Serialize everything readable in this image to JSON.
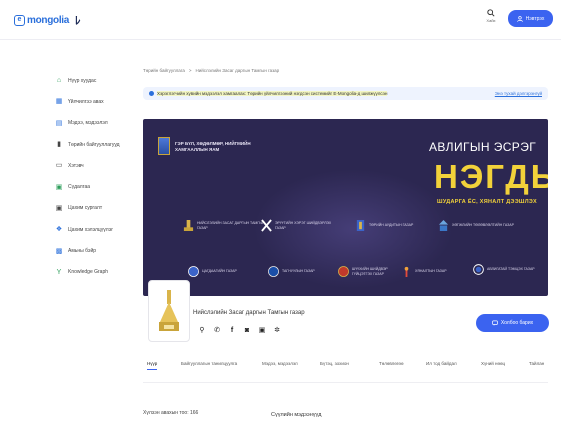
{
  "header": {
    "logo_text": "mongolia",
    "logo_letter": "e",
    "search_label": "Хайх",
    "login_label": "Нэвтрэх"
  },
  "sidebar": {
    "items": [
      {
        "label": "Нүүр хуудас",
        "icon": "home-icon"
      },
      {
        "label": "Үйлчилгээ авах",
        "icon": "services-icon"
      },
      {
        "label": "Мэдээ, мэдээлэл",
        "icon": "news-icon"
      },
      {
        "label": "Төрийн байгууллагууд",
        "icon": "organization-icon"
      },
      {
        "label": "Хэтэвч",
        "icon": "wallet-icon"
      },
      {
        "label": "Сүдалгаа",
        "icon": "survey-icon"
      },
      {
        "label": "Цахим сургалт",
        "icon": "e-learning-icon"
      },
      {
        "label": "Цахим хэлэлцүүлэг",
        "icon": "discussion-icon"
      },
      {
        "label": "Амьны бэйр",
        "icon": "life-event-icon"
      },
      {
        "label": "Knowledge Graph",
        "icon": "knowledge-graph-icon"
      }
    ]
  },
  "breadcrumb": {
    "parent": "Төрийн байгууллага",
    "separator": ">",
    "current": "Нийслэлийн Засаг даргын Тамгын газар"
  },
  "notice": {
    "text": "Хэрэглэгчийн хувийн мэдээлэл хамгаалах: Төрийн үйлчилгээний нэгдсэн системийг E-Mongolia-д шилжүүлсэн",
    "link": "Энэ тухай дэлгэрэнгүй"
  },
  "banner": {
    "org_line": "ГЭР БҮЛ, ХӨДӨЛМӨР, НИЙГМИЙН ХАМГААЛЛЫН ЯАМ",
    "title_small": "АВЛИГЫН ЭСРЭГ",
    "title_big": "НЭГДЬЕ",
    "slogan": "ШУДАРГА ЁС, ХЯНАЛТ ДЭЭШЛЭХ",
    "logos": [
      {
        "text": "НИЙСЛЭЛИЙН ЗАСАГ ДАРГЫН ТАМГЫН ГАЗАР",
        "icon": "building-icon"
      },
      {
        "text": "ЭРҮҮГИЙН ХЭРЭГ ШИЙДВЭРЛЭХ ГАЗАР",
        "icon": "crossed-keys-icon"
      },
      {
        "text": "ТӨРИЙН АУДИТЫН ГАЗАР",
        "icon": "emblem-icon"
      },
      {
        "text": "ХӨГЖЛИЙН ТӨЛӨВЛӨЛТИЙН ГАЗАР",
        "icon": "landmark-icon"
      },
      {
        "text": "ЦАГДААГИЙН ГАЗАР",
        "icon": "police-badge-icon"
      },
      {
        "text": "ТАГНУУЛЫН ГАЗАР",
        "icon": "seal-icon"
      },
      {
        "text": "ШҮҮХИЙН ШИЙДВЭР ГҮЙЦЭТГЭХ ГАЗАР",
        "icon": "crest-icon"
      },
      {
        "text": "ХЯНАЛТЫН ГАЗАР",
        "icon": "torch-icon"
      },
      {
        "text": "АВЛИГАТАЙ ТЭМЦЭХ ГАЗАР",
        "icon": "circle-logo-icon"
      }
    ]
  },
  "profile": {
    "name": "Нийслэлийн Засаг даргын Тамгын газар",
    "contact_label": "Холбоо барих"
  },
  "tabs": [
    {
      "label": "Нүүр",
      "active": true
    },
    {
      "label": "Байгууллагын танилцуулга"
    },
    {
      "label": "Мэдээ, мэдээлэл"
    },
    {
      "label": "Бүтэц, зохион"
    },
    {
      "label": "Төлөвлөгөө"
    },
    {
      "label": "Ил тод байдал"
    },
    {
      "label": "Хүний нөөц"
    },
    {
      "label": "Тайлан"
    }
  ],
  "bottom": {
    "left": "Хүлээн авахын тоо: 166",
    "right": "Сүүлийн мэдээнүүд"
  },
  "colors": {
    "brand": "#2a6fdb",
    "button": "#3b63f0",
    "banner_bg": "#2c2751",
    "banner_accent": "#f2d23a"
  }
}
